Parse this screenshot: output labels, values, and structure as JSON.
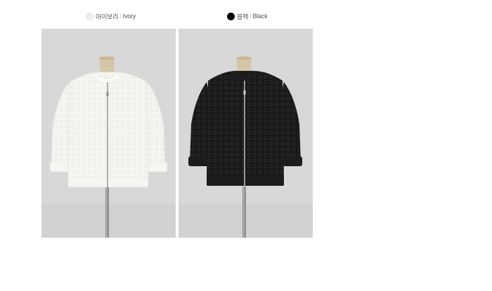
{
  "variants": [
    {
      "color_name_ko": "아이보리",
      "separator": "/",
      "color_name_en": "Ivory",
      "swatch_color": "#ececec",
      "garment_color": "#f7f7f4"
    },
    {
      "color_name_ko": "블랙",
      "separator": "/",
      "color_name_en": "Black",
      "swatch_color": "#000000",
      "garment_color": "#141414"
    }
  ],
  "background_color": "#d8d8d8",
  "lace_icon": "lace-pattern"
}
